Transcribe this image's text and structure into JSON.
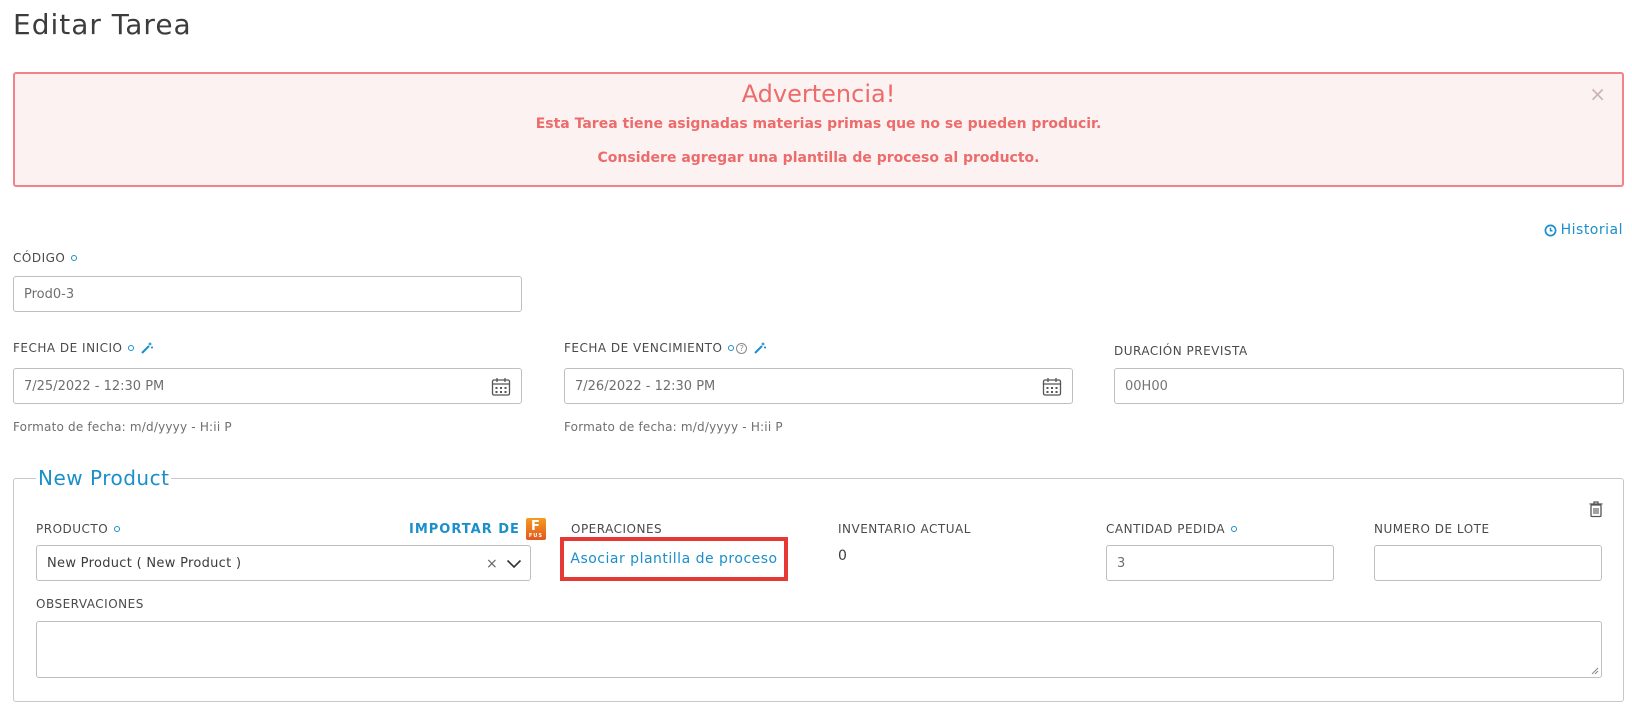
{
  "page": {
    "title": "Editar Tarea"
  },
  "alert": {
    "title": "Advertencia!",
    "line1": "Esta Tarea tiene asignadas materias primas que no se pueden producir.",
    "line2": "Considere agregar una plantilla de proceso al producto.",
    "close": "×"
  },
  "history": {
    "label": "Historial"
  },
  "codigo": {
    "label": "CÓDIGO",
    "value": "Prod0-3"
  },
  "fecha_inicio": {
    "label": "FECHA DE INICIO",
    "value": "7/25/2022 - 12:30 PM",
    "hint": "Formato de fecha: m/d/yyyy - H:ii P"
  },
  "fecha_vencimiento": {
    "label": "FECHA DE VENCIMIENTO",
    "value": "7/26/2022 - 12:30 PM",
    "hint": "Formato de fecha: m/d/yyyy - H:ii P"
  },
  "duracion": {
    "label": "DURACIÓN PREVISTA",
    "placeholder": "00H00"
  },
  "product_section": {
    "legend": "New Product",
    "producto_label": "PRODUCTO",
    "import_label": "IMPORTAR DE",
    "fusion_letter": "F",
    "fusion_sub": "FUS",
    "producto_value": "New Product ( New Product )",
    "clear": "×",
    "operaciones_label": "OPERACIONES",
    "assoc_link": "Asociar plantilla de proceso",
    "inventario_label": "INVENTARIO ACTUAL",
    "inventario_value": "0",
    "cantidad_label": "CANTIDAD PEDIDA",
    "cantidad_value": "3",
    "lote_label": "NUMERO DE LOTE",
    "lote_value": "",
    "observaciones_label": "OBSERVACIONES"
  },
  "colors": {
    "accent": "#1a8fca",
    "alert_text": "#ec6b6b",
    "alert_border": "#f2838a",
    "alert_bg": "#fdf2f2",
    "highlight": "#e53935"
  }
}
